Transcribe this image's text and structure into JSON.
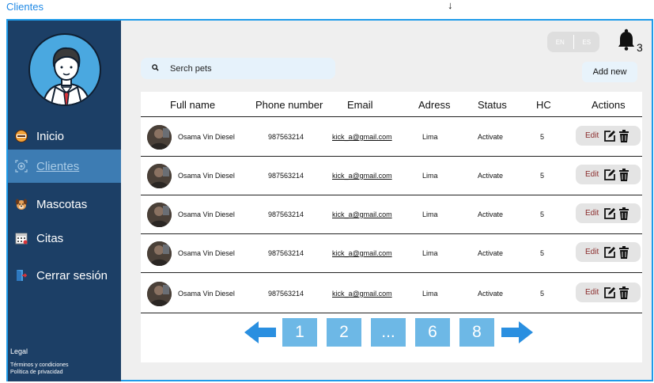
{
  "window": {
    "title": "Clientes"
  },
  "sidebar": {
    "items": [
      {
        "label": "Inicio",
        "icon": "start-badge-icon",
        "active": false
      },
      {
        "label": "Clientes",
        "icon": "clients-icon",
        "active": true
      },
      {
        "label": "Mascotas",
        "icon": "dog-face-icon",
        "active": false
      },
      {
        "label": "Citas",
        "icon": "calendar-icon",
        "active": false
      },
      {
        "label": "Cerrar sesión",
        "icon": "logout-door-icon",
        "active": false
      }
    ],
    "legal_title": "Legal",
    "legal_links": [
      "Términos y condiciones",
      "Política de privacidad"
    ]
  },
  "topbar": {
    "search_placeholder": "Serch pets",
    "lang_en": "EN",
    "lang_es": "ES",
    "notification_count": "3",
    "add_new_label": "Add new"
  },
  "table": {
    "headers": [
      "Full name",
      "Phone number",
      "Email",
      "Adress",
      "Status",
      "HC",
      "Actions"
    ],
    "rows": [
      {
        "name": "Osama Vin Diesel",
        "phone": "987563214",
        "email": "kick_a@gmail.com",
        "address": "Lima",
        "status": "Activate",
        "hc": "5",
        "edit": "Edit"
      },
      {
        "name": "Osama Vin Diesel",
        "phone": "987563214",
        "email": "kick_a@gmail.com",
        "address": "Lima",
        "status": "Activate",
        "hc": "5",
        "edit": "Edit"
      },
      {
        "name": "Osama Vin Diesel",
        "phone": "987563214",
        "email": "kick_a@gmail.com",
        "address": "Lima",
        "status": "Activate",
        "hc": "5",
        "edit": "Edit"
      },
      {
        "name": "Osama Vin Diesel",
        "phone": "987563214",
        "email": "kick_a@gmail.com",
        "address": "Lima",
        "status": "Activate",
        "hc": "5",
        "edit": "Edit"
      },
      {
        "name": "Osama Vin Diesel",
        "phone": "987563214",
        "email": "kick_a@gmail.com",
        "address": "Lima",
        "status": "Activate",
        "hc": "5",
        "edit": "Edit"
      }
    ]
  },
  "pagination": {
    "pages": [
      "1",
      "2",
      "...",
      "6",
      "8"
    ]
  },
  "colors": {
    "sidebar_bg": "#1c3f66",
    "active_item": "#3d7cb3",
    "accent": "#1e9be9",
    "page_button": "#6db8e6",
    "arrow": "#2a8fe0"
  }
}
